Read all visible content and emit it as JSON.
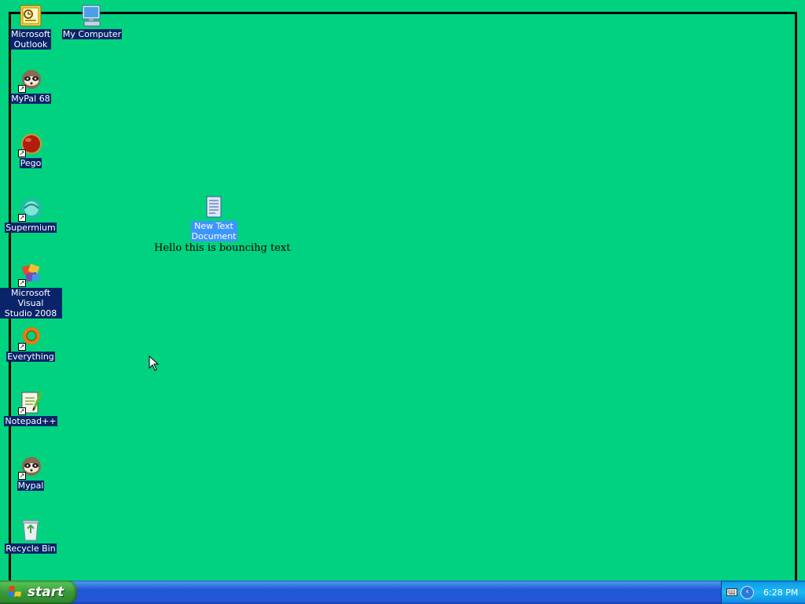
{
  "desktop": {
    "background_color": "#00d27f",
    "icons": [
      {
        "name": "outlook",
        "label": "Microsoft\nOutlook",
        "icon": "outlook-icon",
        "selected": false,
        "shortcut": false
      },
      {
        "name": "my-computer",
        "label": "My Computer",
        "icon": "computer-icon",
        "selected": false,
        "shortcut": false
      },
      {
        "name": "mypal68",
        "label": "MyPal 68",
        "icon": "raccoon-icon",
        "selected": false,
        "shortcut": true
      },
      {
        "name": "pego",
        "label": "Pego",
        "icon": "red-ball-icon",
        "selected": false,
        "shortcut": true
      },
      {
        "name": "supermium",
        "label": "Supermium",
        "icon": "teal-globe-icon",
        "selected": false,
        "shortcut": true
      },
      {
        "name": "visual-studio",
        "label": "Microsoft Visual\nStudio 2008",
        "icon": "visual-studio-icon",
        "selected": false,
        "shortcut": true
      },
      {
        "name": "everything",
        "label": "Everything",
        "icon": "orange-ring-icon",
        "selected": false,
        "shortcut": true
      },
      {
        "name": "notepadpp",
        "label": "Notepad++",
        "icon": "notepadpp-icon",
        "selected": false,
        "shortcut": true
      },
      {
        "name": "mypal",
        "label": "Mypal",
        "icon": "raccoon-icon",
        "selected": false,
        "shortcut": true
      },
      {
        "name": "recycle-bin",
        "label": "Recycle Bin",
        "icon": "recycle-bin-icon",
        "selected": false,
        "shortcut": false
      },
      {
        "name": "new-text-document",
        "label": "New Text\nDocument",
        "icon": "text-document-icon",
        "selected": true,
        "shortcut": false
      }
    ],
    "overlay_text": "Hello this is bouncihg text"
  },
  "taskbar": {
    "start_label": "start",
    "clock": "6:28 PM",
    "tray_chevron": "‹"
  }
}
